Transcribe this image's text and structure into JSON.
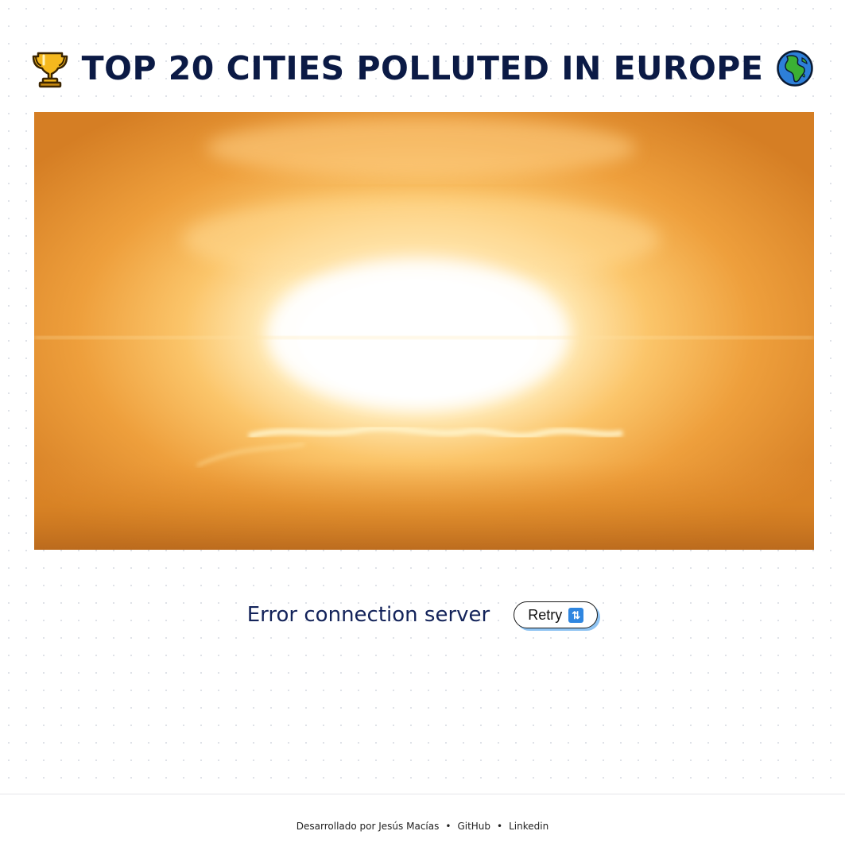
{
  "header": {
    "title": "TOP 20 CITIES POLLUTED IN EUROPE",
    "left_icon": "trophy-icon",
    "right_icon": "globe-africa-icon"
  },
  "hero": {
    "image": "explosion-gif"
  },
  "status": {
    "error_text": "Error connection server",
    "retry_label": "Retry",
    "retry_icon": "refresh-icon",
    "retry_glyph": "⇅"
  },
  "footer": {
    "credit": "Desarrollado por Jesús Macías",
    "separator": "•",
    "links": [
      "GitHub",
      "Linkedin"
    ]
  },
  "colors": {
    "title": "#0b1a45",
    "error_text": "#13235a",
    "retry_shadow": "#8ec3f2",
    "refresh_icon_bg": "#2f86e0",
    "hero_orange": "#e8962e"
  }
}
